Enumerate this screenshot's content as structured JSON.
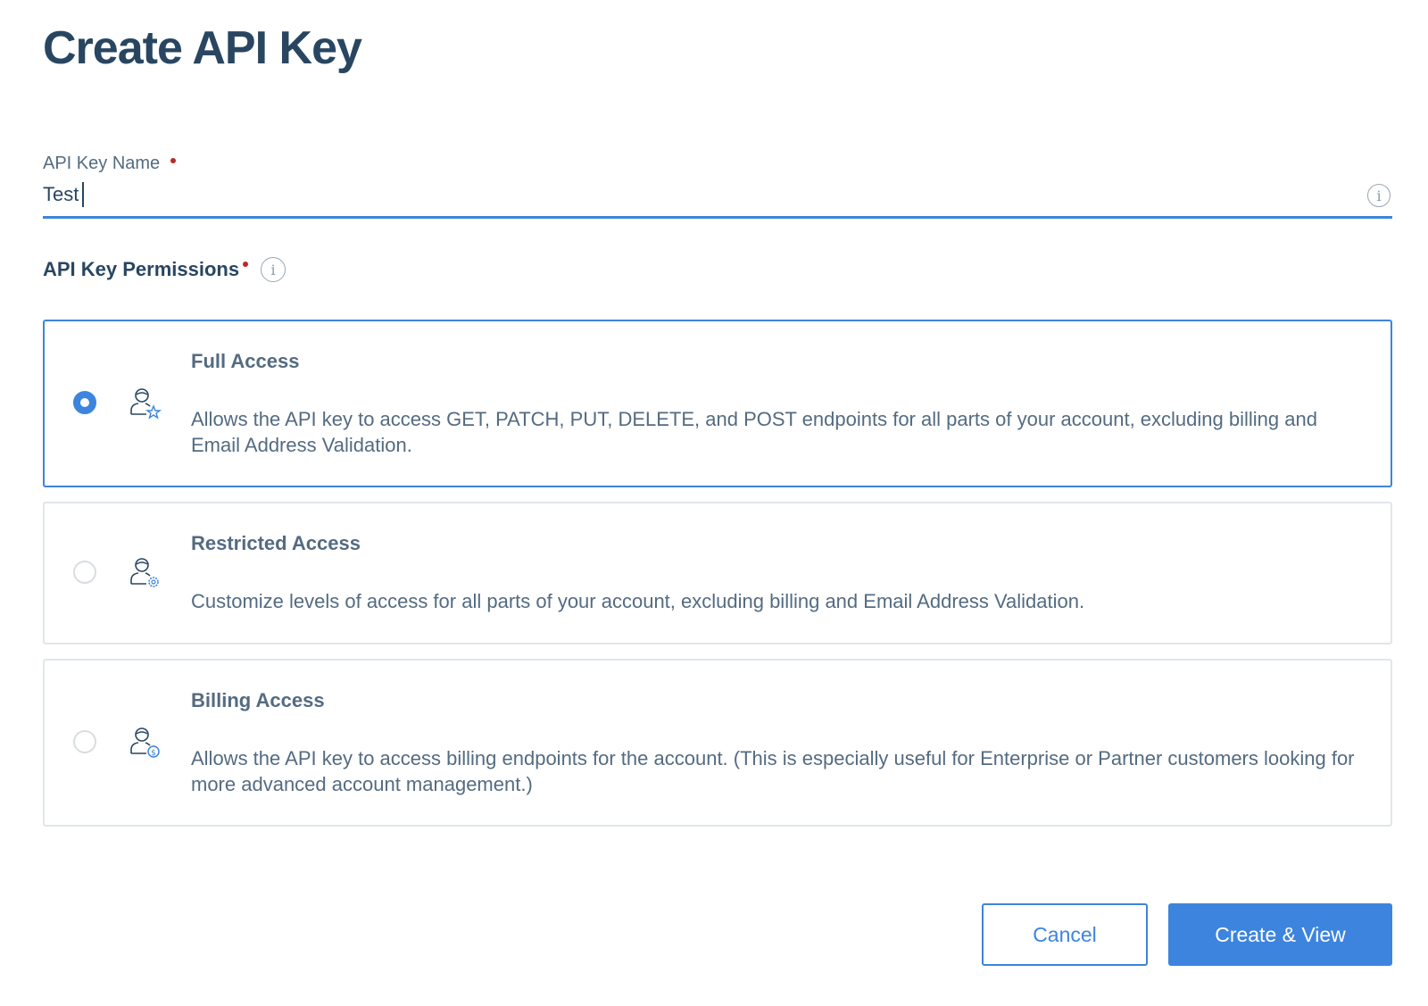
{
  "page": {
    "title": "Create API Key"
  },
  "name_field": {
    "label": "API Key Name",
    "required": true,
    "value": "Test",
    "info_icon": "info-icon"
  },
  "permissions": {
    "label": "API Key Permissions",
    "required": true,
    "info_icon": "info-icon",
    "selected": "full",
    "options": [
      {
        "id": "full",
        "title": "Full Access",
        "description": "Allows the API key to access GET, PATCH, PUT, DELETE, and POST endpoints for all parts of your account, excluding billing and Email Address Validation.",
        "icon": "user-star-icon",
        "checked": true
      },
      {
        "id": "restricted",
        "title": "Restricted Access",
        "description": "Customize levels of access for all parts of your account, excluding billing and Email Address Validation.",
        "icon": "user-gear-icon",
        "checked": false
      },
      {
        "id": "billing",
        "title": "Billing Access",
        "description": "Allows the API key to access billing endpoints for the account. (This is especially useful for Enterprise or Partner customers looking for more advanced account management.)",
        "icon": "user-dollar-icon",
        "checked": false
      }
    ]
  },
  "actions": {
    "cancel_label": "Cancel",
    "create_label": "Create & View"
  },
  "colors": {
    "accent": "#3d84de",
    "heading": "#294661",
    "body_text": "#546b81",
    "required": "#c0262d",
    "border": "#e1e6ea"
  }
}
